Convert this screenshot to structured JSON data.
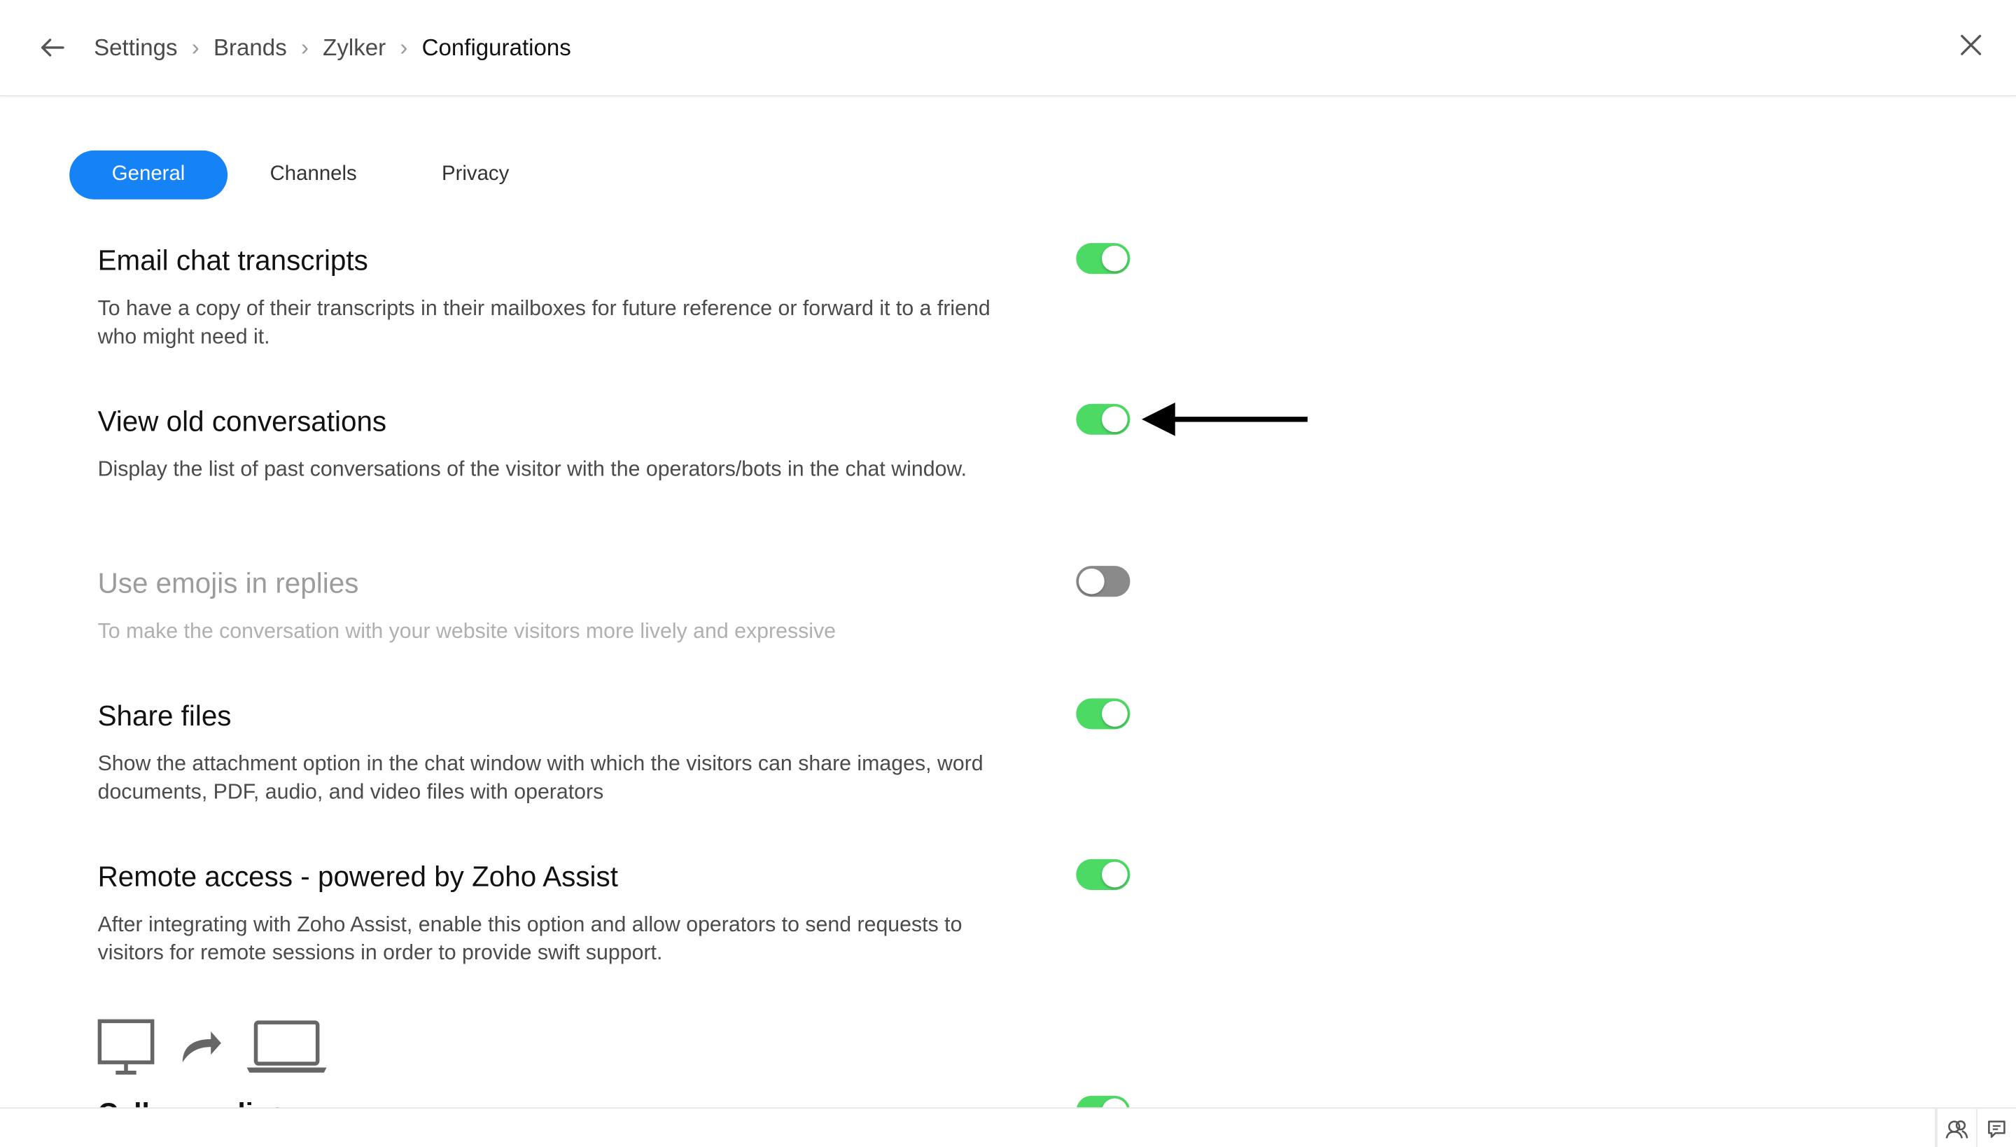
{
  "breadcrumb": {
    "items": [
      "Settings",
      "Brands",
      "Zylker",
      "Configurations"
    ],
    "separator": "›"
  },
  "tabs": [
    {
      "label": "General",
      "active": true
    },
    {
      "label": "Channels",
      "active": false
    },
    {
      "label": "Privacy",
      "active": false
    }
  ],
  "settings": [
    {
      "title": "Email chat transcripts",
      "description": "To have a copy of their transcripts in their mailboxes for future reference or forward it to a friend who might need it.",
      "enabled": true,
      "disabled_style": false
    },
    {
      "title": "View old conversations",
      "description": "Display the list of past conversations of the visitor with the operators/bots in the chat window.",
      "enabled": true,
      "disabled_style": false
    },
    {
      "title": "Use emojis in replies",
      "description": "To make the conversation with your website visitors more lively and expressive",
      "enabled": false,
      "disabled_style": true
    },
    {
      "title": "Share files",
      "description": "Show the attachment option in the chat window with which the visitors can share images, word documents, PDF, audio, and video files with operators",
      "enabled": true,
      "disabled_style": false
    },
    {
      "title": "Remote access - powered by Zoho Assist",
      "description": "After integrating with Zoho Assist, enable this option and allow operators to send requests to visitors for remote sessions in order to provide swift support.",
      "enabled": true,
      "disabled_style": false
    }
  ],
  "partial_next_title": "Call recording",
  "colors": {
    "accent": "#1582f5",
    "toggle_on": "#4cd964",
    "toggle_off": "#8a8a8a"
  },
  "icons": {
    "back": "arrow-left-icon",
    "close": "close-icon",
    "annotation": "arrow-pointer-icon",
    "remote_illustration": [
      "monitor-icon",
      "share-arrow-icon",
      "laptop-icon"
    ],
    "footer": [
      "people-search-icon",
      "chat-bubble-icon"
    ]
  }
}
